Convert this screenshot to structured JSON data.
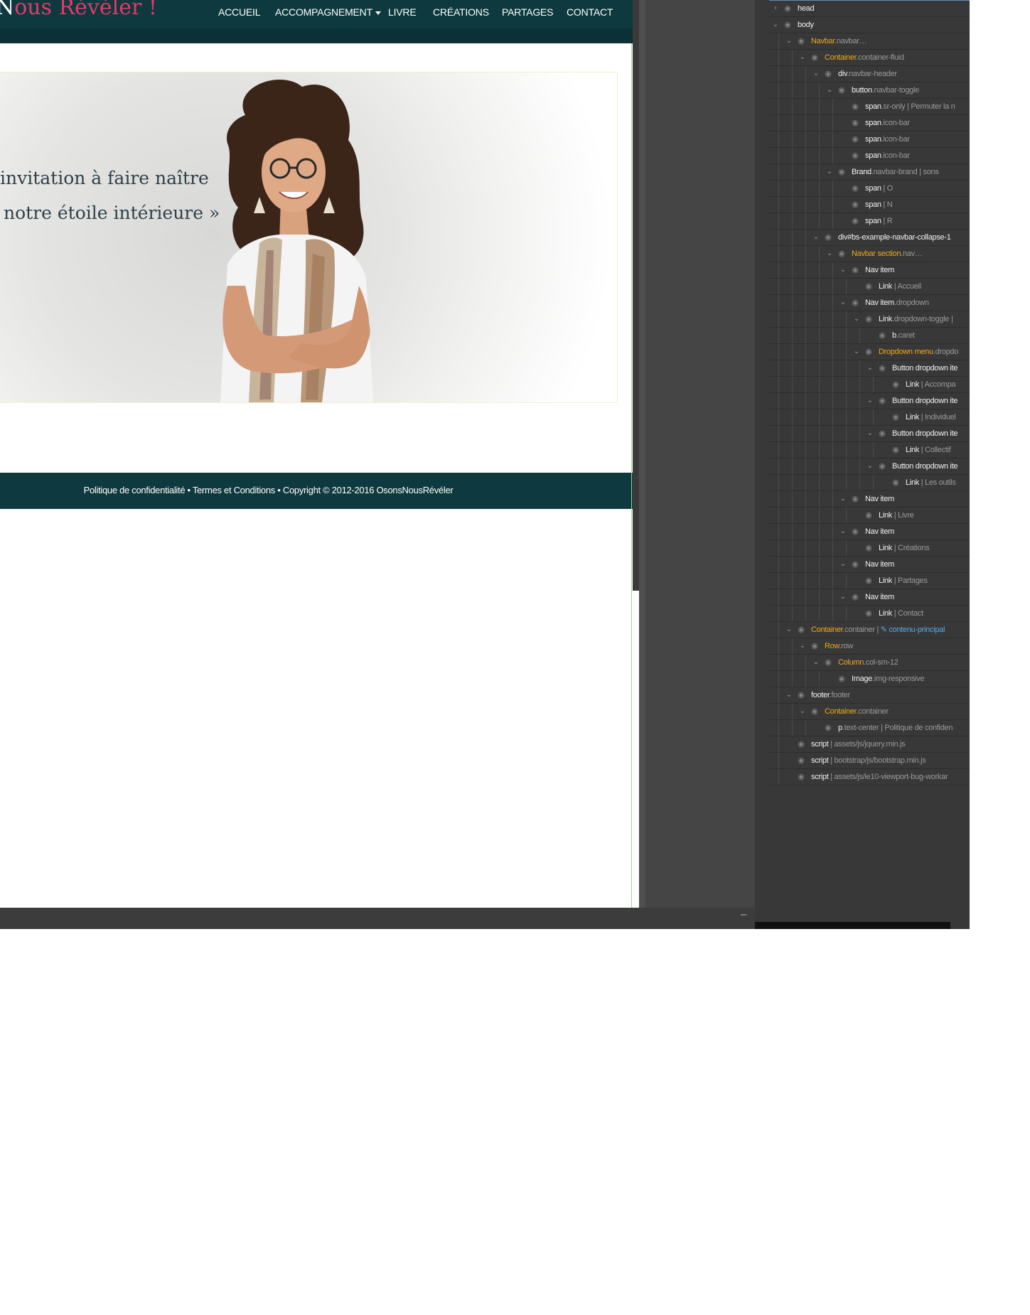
{
  "brand": {
    "first_letter": "N",
    "rest": "ous Révéler !"
  },
  "nav": {
    "items": [
      "ACCUEIL",
      "ACCOMPAGNEMENT",
      "LIVRE",
      "CRÉATIONS",
      "PARTAGES",
      "CONTACT"
    ]
  },
  "hero": {
    "quote_line1": "invitation à faire naître",
    "quote_line2": "notre étoile intérieure »"
  },
  "footer": {
    "text": "Politique de confidentialité • Termes et Conditions • Copyright © 2012-2016 OsonsNousRévéler"
  },
  "bottombar": {
    "minimize": "–"
  },
  "tree": [
    {
      "depth": 0,
      "arrow": "›",
      "parts": [
        [
          "head",
          "white"
        ]
      ]
    },
    {
      "depth": 0,
      "arrow": "⌄",
      "parts": [
        [
          "body",
          "white"
        ]
      ]
    },
    {
      "depth": 1,
      "arrow": "⌄",
      "parts": [
        [
          "Navbar",
          "orange"
        ],
        [
          ".navbar…",
          "gray"
        ]
      ]
    },
    {
      "depth": 2,
      "arrow": "⌄",
      "parts": [
        [
          "Container",
          "orange"
        ],
        [
          ".container-fluid",
          "gray"
        ]
      ]
    },
    {
      "depth": 3,
      "arrow": "⌄",
      "parts": [
        [
          "div",
          "white"
        ],
        [
          ".navbar-header",
          "gray"
        ]
      ]
    },
    {
      "depth": 4,
      "arrow": "⌄",
      "parts": [
        [
          "button",
          "white"
        ],
        [
          ".navbar-toggle",
          "gray"
        ]
      ]
    },
    {
      "depth": 5,
      "arrow": "",
      "parts": [
        [
          "span",
          "white"
        ],
        [
          ".sr-only | Permuter la n",
          "gray"
        ]
      ]
    },
    {
      "depth": 5,
      "arrow": "",
      "parts": [
        [
          "span",
          "white"
        ],
        [
          ".icon-bar",
          "gray"
        ]
      ]
    },
    {
      "depth": 5,
      "arrow": "",
      "parts": [
        [
          "span",
          "white"
        ],
        [
          ".icon-bar",
          "gray"
        ]
      ]
    },
    {
      "depth": 5,
      "arrow": "",
      "parts": [
        [
          "span",
          "white"
        ],
        [
          ".icon-bar",
          "gray"
        ]
      ]
    },
    {
      "depth": 4,
      "arrow": "⌄",
      "parts": [
        [
          "Brand",
          "white"
        ],
        [
          ".navbar-brand | sons",
          "gray"
        ]
      ]
    },
    {
      "depth": 5,
      "arrow": "",
      "parts": [
        [
          "span",
          "white"
        ],
        [
          " | O",
          "gray"
        ]
      ]
    },
    {
      "depth": 5,
      "arrow": "",
      "parts": [
        [
          "span",
          "white"
        ],
        [
          " | N",
          "gray"
        ]
      ]
    },
    {
      "depth": 5,
      "arrow": "",
      "parts": [
        [
          "span",
          "white"
        ],
        [
          " | R",
          "gray"
        ]
      ]
    },
    {
      "depth": 3,
      "arrow": "⌄",
      "parts": [
        [
          "div#bs-example-navbar-collapse-1",
          "white"
        ]
      ]
    },
    {
      "depth": 4,
      "arrow": "⌄",
      "parts": [
        [
          "Navbar section",
          "orange"
        ],
        [
          ".nav…",
          "gray"
        ]
      ]
    },
    {
      "depth": 5,
      "arrow": "⌄",
      "parts": [
        [
          "Nav item",
          "white"
        ]
      ]
    },
    {
      "depth": 6,
      "arrow": "",
      "parts": [
        [
          "Link",
          "white"
        ],
        [
          " | Accueil",
          "gray"
        ]
      ]
    },
    {
      "depth": 5,
      "arrow": "⌄",
      "parts": [
        [
          "Nav item",
          "white"
        ],
        [
          ".dropdown",
          "gray"
        ]
      ]
    },
    {
      "depth": 6,
      "arrow": "⌄",
      "parts": [
        [
          "Link",
          "white"
        ],
        [
          ".dropdown-toggle |",
          "gray"
        ]
      ]
    },
    {
      "depth": 7,
      "arrow": "",
      "parts": [
        [
          "b",
          "white"
        ],
        [
          ".caret",
          "gray"
        ]
      ]
    },
    {
      "depth": 6,
      "arrow": "⌄",
      "parts": [
        [
          "Dropdown menu",
          "orange"
        ],
        [
          ".dropdo",
          "gray"
        ]
      ]
    },
    {
      "depth": 7,
      "arrow": "⌄",
      "parts": [
        [
          "Button dropdown ite",
          "white"
        ]
      ]
    },
    {
      "depth": 8,
      "arrow": "",
      "parts": [
        [
          "Link",
          "white"
        ],
        [
          " | Accompa",
          "gray"
        ]
      ]
    },
    {
      "depth": 7,
      "arrow": "⌄",
      "parts": [
        [
          "Button dropdown ite",
          "white"
        ]
      ]
    },
    {
      "depth": 8,
      "arrow": "",
      "parts": [
        [
          "Link",
          "white"
        ],
        [
          " | Individuel",
          "gray"
        ]
      ]
    },
    {
      "depth": 7,
      "arrow": "⌄",
      "parts": [
        [
          "Button dropdown ite",
          "white"
        ]
      ]
    },
    {
      "depth": 8,
      "arrow": "",
      "parts": [
        [
          "Link",
          "white"
        ],
        [
          " | Collectif",
          "gray"
        ]
      ]
    },
    {
      "depth": 7,
      "arrow": "⌄",
      "parts": [
        [
          "Button dropdown ite",
          "white"
        ]
      ]
    },
    {
      "depth": 8,
      "arrow": "",
      "parts": [
        [
          "Link",
          "white"
        ],
        [
          " | Les outils",
          "gray"
        ]
      ]
    },
    {
      "depth": 5,
      "arrow": "⌄",
      "parts": [
        [
          "Nav item",
          "white"
        ]
      ]
    },
    {
      "depth": 6,
      "arrow": "",
      "parts": [
        [
          "Link",
          "white"
        ],
        [
          " | Livre",
          "gray"
        ]
      ]
    },
    {
      "depth": 5,
      "arrow": "⌄",
      "parts": [
        [
          "Nav item",
          "white"
        ]
      ]
    },
    {
      "depth": 6,
      "arrow": "",
      "parts": [
        [
          "Link",
          "white"
        ],
        [
          " | Créations",
          "gray"
        ]
      ]
    },
    {
      "depth": 5,
      "arrow": "⌄",
      "parts": [
        [
          "Nav item",
          "white"
        ]
      ]
    },
    {
      "depth": 6,
      "arrow": "",
      "parts": [
        [
          "Link",
          "white"
        ],
        [
          " | Partages",
          "gray"
        ]
      ]
    },
    {
      "depth": 5,
      "arrow": "⌄",
      "parts": [
        [
          "Nav item",
          "white"
        ]
      ]
    },
    {
      "depth": 6,
      "arrow": "",
      "parts": [
        [
          "Link",
          "white"
        ],
        [
          " | Contact",
          "gray"
        ]
      ]
    },
    {
      "depth": 1,
      "arrow": "⌄",
      "parts": [
        [
          "Container",
          "orange"
        ],
        [
          ".container | ",
          "gray"
        ],
        [
          "✎ contenu-principal",
          "blue"
        ]
      ]
    },
    {
      "depth": 2,
      "arrow": "⌄",
      "parts": [
        [
          "Row",
          "orange"
        ],
        [
          ".row",
          "gray"
        ]
      ]
    },
    {
      "depth": 3,
      "arrow": "⌄",
      "parts": [
        [
          "Column",
          "orange"
        ],
        [
          ".col-sm-12",
          "gray"
        ]
      ]
    },
    {
      "depth": 4,
      "arrow": "",
      "parts": [
        [
          "Image",
          "white"
        ],
        [
          ".img-responsive",
          "gray"
        ]
      ]
    },
    {
      "depth": 1,
      "arrow": "⌄",
      "parts": [
        [
          "footer",
          "white"
        ],
        [
          ".footer",
          "gray"
        ]
      ]
    },
    {
      "depth": 2,
      "arrow": "⌄",
      "parts": [
        [
          "Container",
          "orange"
        ],
        [
          ".container",
          "gray"
        ]
      ]
    },
    {
      "depth": 3,
      "arrow": "",
      "parts": [
        [
          "p",
          "white"
        ],
        [
          ".text-center | Politique de confiden",
          "gray"
        ]
      ]
    },
    {
      "depth": 1,
      "arrow": "",
      "parts": [
        [
          "script",
          "white"
        ],
        [
          " | assets/js/jquery.min.js",
          "gray"
        ]
      ]
    },
    {
      "depth": 1,
      "arrow": "",
      "parts": [
        [
          "script",
          "white"
        ],
        [
          " | bootstrap/js/bootstrap.min.js",
          "gray"
        ]
      ]
    },
    {
      "depth": 1,
      "arrow": "",
      "parts": [
        [
          "script",
          "white"
        ],
        [
          " | assets/js/ie10-viewport-bug-workar",
          "gray"
        ]
      ]
    }
  ],
  "colors": {
    "navbar_bg": "#0e3a3f",
    "brand_accent": "#e5396a",
    "tree_component": "#f0a81c",
    "tree_class": "#9a9a9a",
    "tree_id": "#5aa9e6"
  },
  "icons": {
    "visibility": "eye-icon",
    "expand": "disclosure-arrow-icon"
  }
}
